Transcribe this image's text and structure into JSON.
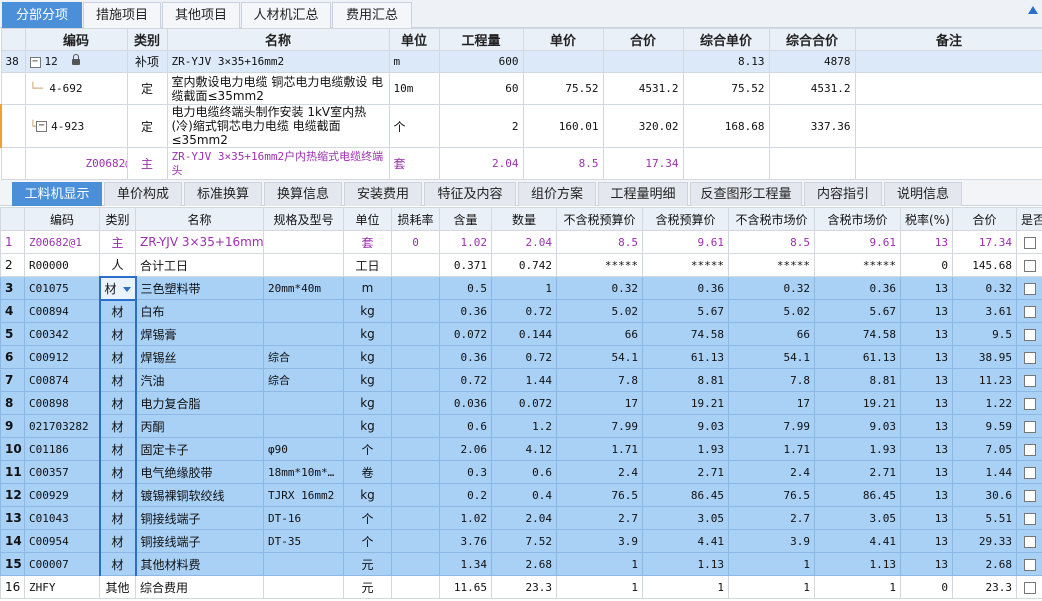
{
  "top_tabs": [
    "分部分项",
    "措施项目",
    "其他项目",
    "人材机汇总",
    "费用汇总"
  ],
  "upper_headers": [
    "编码",
    "类别",
    "名称",
    "单位",
    "工程量",
    "单价",
    "合价",
    "综合单价",
    "综合合价",
    "备注"
  ],
  "upper_rows": [
    {
      "rownum": "38",
      "code": "12",
      "type": "补项",
      "name": "ZR-YJV 3×35+16mm2",
      "unit": "m",
      "qty": "600",
      "price": "",
      "amount": "",
      "uprice": "8.13",
      "uamount": "4878",
      "note": ""
    },
    {
      "rownum": "",
      "code": "4-692",
      "type": "定",
      "name": "室内敷设电力电缆 铜芯电力电缆敷设 电缆截面≤35mm2",
      "unit": "10m",
      "qty": "60",
      "price": "75.52",
      "amount": "4531.2",
      "uprice": "75.52",
      "uamount": "4531.2",
      "note": ""
    },
    {
      "rownum": "",
      "code": "4-923",
      "type": "定",
      "name": "电力电缆终端头制作安装 1kV室内热(冷)缩式铜芯电力电缆 电缆截面≤35mm2",
      "unit": "个",
      "qty": "2",
      "price": "160.01",
      "amount": "320.02",
      "uprice": "168.68",
      "uamount": "337.36",
      "note": ""
    },
    {
      "rownum": "",
      "code": "Z00682@1",
      "type": "主",
      "name": "ZR-YJV 3×35+16mm2户内热缩式电缆终端头",
      "unit": "套",
      "qty": "2.04",
      "price": "8.5",
      "amount": "17.34",
      "uprice": "",
      "uamount": "",
      "note": ""
    }
  ],
  "mid_tabs": [
    "工料机显示",
    "单价构成",
    "标准换算",
    "换算信息",
    "安装费用",
    "特征及内容",
    "组价方案",
    "工程量明细",
    "反查图形工程量",
    "内容指引",
    "说明信息"
  ],
  "lower_headers": [
    "",
    "编码",
    "类别",
    "名称",
    "规格及型号",
    "单位",
    "损耗率",
    "含量",
    "数量",
    "不含税预算价",
    "含税预算价",
    "不含税市场价",
    "含税市场价",
    "税率(%)",
    "合价",
    "是否"
  ],
  "lower_rows": [
    {
      "n": "1",
      "code": "Z00682@1",
      "type": "主",
      "name": "ZR-YJV 3×35+16mm2…",
      "spec": "",
      "unit": "套",
      "loss": "0",
      "content": "1.02",
      "qty": "2.04",
      "p1": "8.5",
      "p2": "9.61",
      "p3": "8.5",
      "p4": "9.61",
      "tax": "13",
      "total": "17.34"
    },
    {
      "n": "2",
      "code": "R00000",
      "type": "人",
      "name": "合计工日",
      "spec": "",
      "unit": "工日",
      "loss": "",
      "content": "0.371",
      "qty": "0.742",
      "p1": "*****",
      "p2": "*****",
      "p3": "*****",
      "p4": "*****",
      "tax": "0",
      "total": "145.68"
    },
    {
      "n": "3",
      "code": "C01075",
      "type": "材",
      "name": "三色塑料带",
      "spec": "20mm*40m",
      "unit": "m",
      "loss": "",
      "content": "0.5",
      "qty": "1",
      "p1": "0.32",
      "p2": "0.36",
      "p3": "0.32",
      "p4": "0.36",
      "tax": "13",
      "total": "0.32"
    },
    {
      "n": "4",
      "code": "C00894",
      "type": "材",
      "name": "白布",
      "spec": "",
      "unit": "kg",
      "loss": "",
      "content": "0.36",
      "qty": "0.72",
      "p1": "5.02",
      "p2": "5.67",
      "p3": "5.02",
      "p4": "5.67",
      "tax": "13",
      "total": "3.61"
    },
    {
      "n": "5",
      "code": "C00342",
      "type": "材",
      "name": "焊锡膏",
      "spec": "",
      "unit": "kg",
      "loss": "",
      "content": "0.072",
      "qty": "0.144",
      "p1": "66",
      "p2": "74.58",
      "p3": "66",
      "p4": "74.58",
      "tax": "13",
      "total": "9.5"
    },
    {
      "n": "6",
      "code": "C00912",
      "type": "材",
      "name": "焊锡丝",
      "spec": "综合",
      "unit": "kg",
      "loss": "",
      "content": "0.36",
      "qty": "0.72",
      "p1": "54.1",
      "p2": "61.13",
      "p3": "54.1",
      "p4": "61.13",
      "tax": "13",
      "total": "38.95"
    },
    {
      "n": "7",
      "code": "C00874",
      "type": "材",
      "name": "汽油",
      "spec": "综合",
      "unit": "kg",
      "loss": "",
      "content": "0.72",
      "qty": "1.44",
      "p1": "7.8",
      "p2": "8.81",
      "p3": "7.8",
      "p4": "8.81",
      "tax": "13",
      "total": "11.23"
    },
    {
      "n": "8",
      "code": "C00898",
      "type": "材",
      "name": "电力复合脂",
      "spec": "",
      "unit": "kg",
      "loss": "",
      "content": "0.036",
      "qty": "0.072",
      "p1": "17",
      "p2": "19.21",
      "p3": "17",
      "p4": "19.21",
      "tax": "13",
      "total": "1.22"
    },
    {
      "n": "9",
      "code": "021703282",
      "type": "材",
      "name": "丙酮",
      "spec": "",
      "unit": "kg",
      "loss": "",
      "content": "0.6",
      "qty": "1.2",
      "p1": "7.99",
      "p2": "9.03",
      "p3": "7.99",
      "p4": "9.03",
      "tax": "13",
      "total": "9.59"
    },
    {
      "n": "10",
      "code": "C01186",
      "type": "材",
      "name": "固定卡子",
      "spec": "φ90",
      "unit": "个",
      "loss": "",
      "content": "2.06",
      "qty": "4.12",
      "p1": "1.71",
      "p2": "1.93",
      "p3": "1.71",
      "p4": "1.93",
      "tax": "13",
      "total": "7.05"
    },
    {
      "n": "11",
      "code": "C00357",
      "type": "材",
      "name": "电气绝缘胶带",
      "spec": "18mm*10m*…",
      "unit": "卷",
      "loss": "",
      "content": "0.3",
      "qty": "0.6",
      "p1": "2.4",
      "p2": "2.71",
      "p3": "2.4",
      "p4": "2.71",
      "tax": "13",
      "total": "1.44"
    },
    {
      "n": "12",
      "code": "C00929",
      "type": "材",
      "name": "镀锡裸铜软绞线",
      "spec": "TJRX 16mm2",
      "unit": "kg",
      "loss": "",
      "content": "0.2",
      "qty": "0.4",
      "p1": "76.5",
      "p2": "86.45",
      "p3": "76.5",
      "p4": "86.45",
      "tax": "13",
      "total": "30.6"
    },
    {
      "n": "13",
      "code": "C01043",
      "type": "材",
      "name": "铜接线端子",
      "spec": "DT-16",
      "unit": "个",
      "loss": "",
      "content": "1.02",
      "qty": "2.04",
      "p1": "2.7",
      "p2": "3.05",
      "p3": "2.7",
      "p4": "3.05",
      "tax": "13",
      "total": "5.51"
    },
    {
      "n": "14",
      "code": "C00954",
      "type": "材",
      "name": "铜接线端子",
      "spec": "DT-35",
      "unit": "个",
      "loss": "",
      "content": "3.76",
      "qty": "7.52",
      "p1": "3.9",
      "p2": "4.41",
      "p3": "3.9",
      "p4": "4.41",
      "tax": "13",
      "total": "29.33"
    },
    {
      "n": "15",
      "code": "C00007",
      "type": "材",
      "name": "其他材料费",
      "spec": "",
      "unit": "元",
      "loss": "",
      "content": "1.34",
      "qty": "2.68",
      "p1": "1",
      "p2": "1.13",
      "p3": "1",
      "p4": "1.13",
      "tax": "13",
      "total": "2.68"
    },
    {
      "n": "16",
      "code": "ZHFY",
      "type": "其他",
      "name": "综合费用",
      "spec": "",
      "unit": "元",
      "loss": "",
      "content": "11.65",
      "qty": "23.3",
      "p1": "1",
      "p2": "1",
      "p3": "1",
      "p4": "1",
      "tax": "0",
      "total": "23.3"
    }
  ],
  "colors": {
    "accent": "#4a8fd8",
    "selected_rows": "#a9d0f5",
    "main_material": "#9b2fae"
  }
}
